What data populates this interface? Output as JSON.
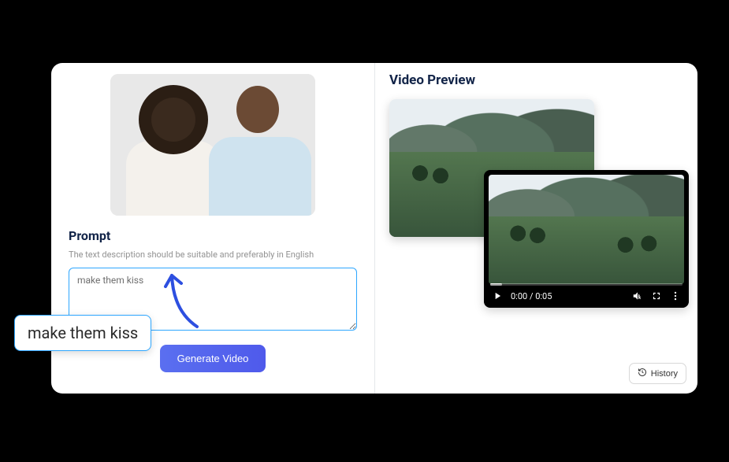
{
  "left": {
    "prompt_title": "Prompt",
    "prompt_hint": "The text description should be suitable and preferably in English",
    "prompt_value": "make them kiss",
    "generate_label": "Generate Video"
  },
  "right": {
    "preview_title": "Video Preview",
    "player": {
      "time": "0:00 / 0:05"
    },
    "history_label": "History"
  },
  "callout": {
    "text": "make them kiss"
  }
}
